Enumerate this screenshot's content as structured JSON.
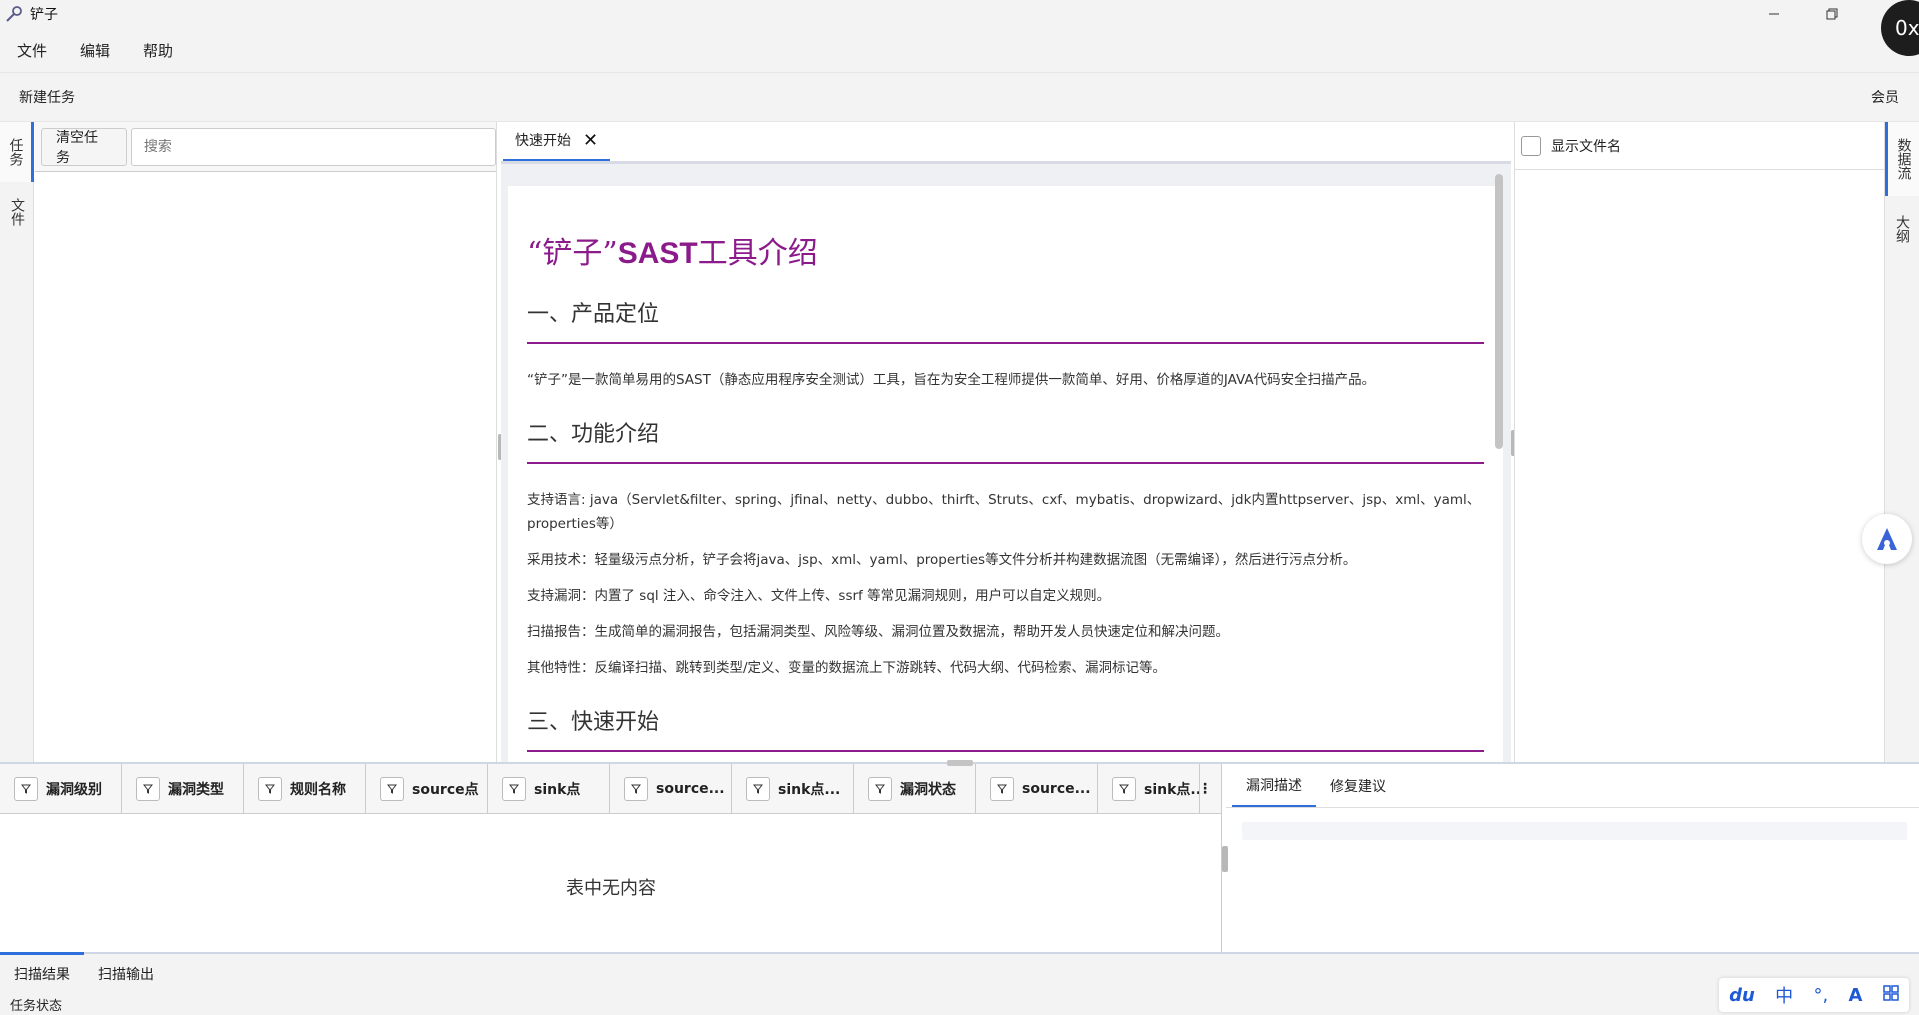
{
  "window": {
    "title": "铲子",
    "overlay": "0x"
  },
  "menu": [
    "文件",
    "编辑",
    "帮助"
  ],
  "toolbar": {
    "new_task": "新建任务",
    "member": "会员"
  },
  "left_tabs": [
    "任务",
    "文件"
  ],
  "task_panel": {
    "clear_button": "清空任务",
    "search_placeholder": "搜索"
  },
  "editor": {
    "tab_label": "快速开始",
    "doc": {
      "title_quote": "“铲子”",
      "title_bold": "SAST",
      "title_rest": "工具介绍",
      "h2_1": "一、产品定位",
      "p_intro": "“铲子”是一款简单易用的SAST（静态应用程序安全测试）工具，旨在为安全工程师提供一款简单、好用、价格厚道的JAVA代码安全扫描产品。",
      "h2_2": "二、功能介绍",
      "features": [
        "支持语言: java（Servlet&filter、spring、jfinal、netty、dubbo、thirft、Struts、cxf、mybatis、dropwizard、jdk内置httpserver、jsp、xml、yaml、properties等）",
        "采用技术：轻量级污点分析，铲子会将java、jsp、xml、yaml、properties等文件分析并构建数据流图（无需编译），然后进行污点分析。",
        "支持漏洞：内置了 sql 注入、命令注入、文件上传、ssrf 等常见漏洞规则，用户可以自定义规则。",
        "扫描报告：生成简单的漏洞报告，包括漏洞类型、风险等级、漏洞位置及数据流，帮助开发人员快速定位和解决问题。",
        "其他特性：反编译扫描、跳转到类型/定义、变量的数据流上下游跳转、代码大纲、代码检索、漏洞标记等。"
      ],
      "h2_3": "三、快速开始"
    }
  },
  "right_panel": {
    "show_filename": "显示文件名"
  },
  "right_tabs": [
    "数据流",
    "大纲"
  ],
  "table": {
    "columns": [
      "漏洞级别",
      "漏洞类型",
      "规则名称",
      "source点",
      "sink点",
      "source...",
      "sink点...",
      "漏洞状态",
      "source...",
      "sink点..."
    ],
    "empty_message": "表中无内容"
  },
  "detail_tabs": [
    "漏洞描述",
    "修复建议"
  ],
  "bottom_tabs": [
    "扫描结果",
    "扫描输出"
  ],
  "status": "任务状态",
  "ime": [
    "du",
    "中",
    "°,",
    "A",
    "grid"
  ]
}
